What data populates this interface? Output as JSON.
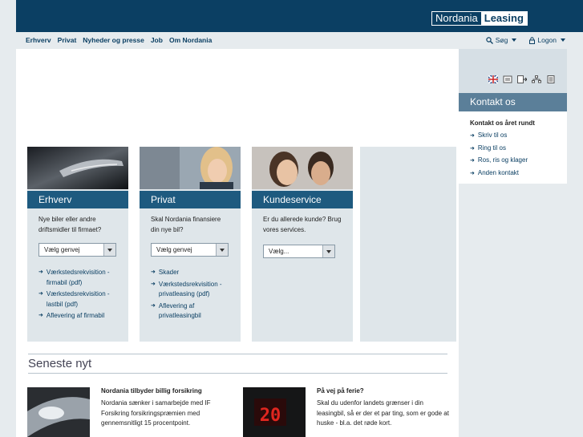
{
  "brand": {
    "part1": "Nordania",
    "part2": "Leasing"
  },
  "nav": [
    "Erhverv",
    "Privat",
    "Nyheder og presse",
    "Job",
    "Om Nordania"
  ],
  "util": {
    "search": "Søg",
    "logon": "Logon"
  },
  "sidebar": {
    "heading": "Kontakt os",
    "subheading": "Kontakt os året rundt",
    "links": [
      "Skriv til os",
      "Ring til os",
      "Ros, ris og klager",
      "Anden kontakt"
    ]
  },
  "cards": [
    {
      "title": "Erhverv",
      "intro": "Nye biler eller andre driftsmidler til firmaet?",
      "select": "Vælg genvej",
      "links": [
        "Værkstedsrekvisition - firmabil (pdf)",
        "Værkstedsrekvisition - lastbil (pdf)",
        "Aflevering af firmabil"
      ]
    },
    {
      "title": "Privat",
      "intro": "Skal Nordania finansiere din nye bil?",
      "select": "Vælg genvej",
      "links": [
        "Skader",
        "Værkstedsrekvisition - privatleasing (pdf)",
        "Aflevering af privatleasingbil"
      ]
    },
    {
      "title": "Kundeservice",
      "intro": "Er du allerede kunde? Brug vores services.",
      "select": "Vælg...",
      "links": []
    }
  ],
  "news": {
    "heading": "Seneste nyt",
    "items": [
      {
        "title": "Nordania tilbyder billig forsikring",
        "text": "Nordania samarbejde med IF Forsikring forsikringspræmien med gennemsnitligt 15 procentpoint."
      },
      {
        "title": "På vej på ferie?",
        "text": "Skal du udenfor landets grænser i din leasingbil, så er der et par ting, som er gode at huske - bl.a. det røde kort."
      }
    ],
    "item1_text_full": "Nordania sænker i samarbejde med IF Forsikring forsikringspræmien med gennemsnitligt 15 procentpoint."
  },
  "colors": {
    "primary": "#0b3f63",
    "cardHeader": "#1e5a7f",
    "sidebarHeader": "#5b7f99"
  }
}
